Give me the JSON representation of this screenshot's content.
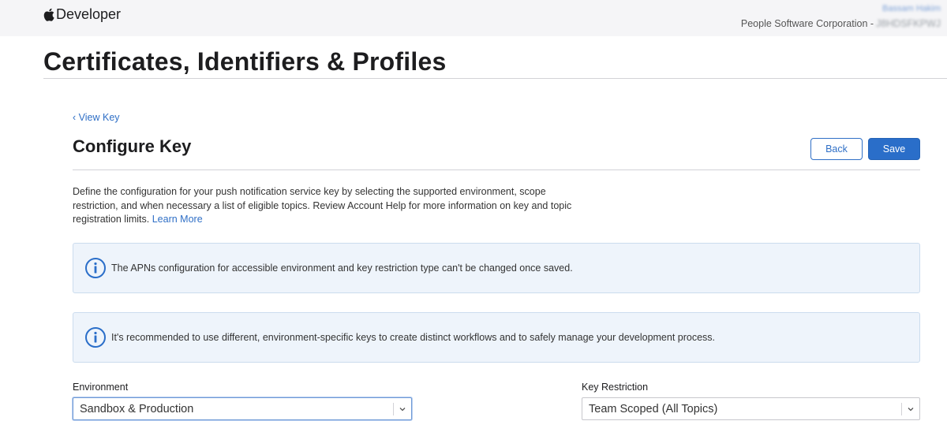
{
  "header": {
    "brand_label": "Developer",
    "user_name": "Bassam Hakim",
    "org_label": "People Software Corporation -",
    "team_id": "J8HDSFKPWJ"
  },
  "page": {
    "title": "Certificates, Identifiers & Profiles"
  },
  "content": {
    "back_link": "‹ View Key",
    "section_title": "Configure Key",
    "buttons": {
      "back_label": "Back",
      "save_label": "Save"
    },
    "description": "Define the configuration for your push notification service key by selecting the supported environment, scope restriction, and when necessary a list of eligible topics. Review Account Help for more information on key and topic registration limits.",
    "learn_more": "Learn More",
    "notices": [
      {
        "text": "The APNs configuration for accessible environment and key restriction type can't be changed once saved."
      },
      {
        "text": "It's recommended to use different, environment-specific keys to create distinct workflows and to safely manage your development process."
      }
    ],
    "fields": {
      "environment": {
        "label": "Environment",
        "value": "Sandbox & Production"
      },
      "key_restriction": {
        "label": "Key Restriction",
        "value": "Team Scoped (All Topics)"
      }
    }
  },
  "colors": {
    "accent": "#2a6ec9",
    "link": "#2f6fc6",
    "notice_bg": "#eef4fb",
    "topbar_bg": "#f5f5f7"
  },
  "icons": [
    "apple-logo-icon",
    "info-icon",
    "chevron-down-icon"
  ]
}
